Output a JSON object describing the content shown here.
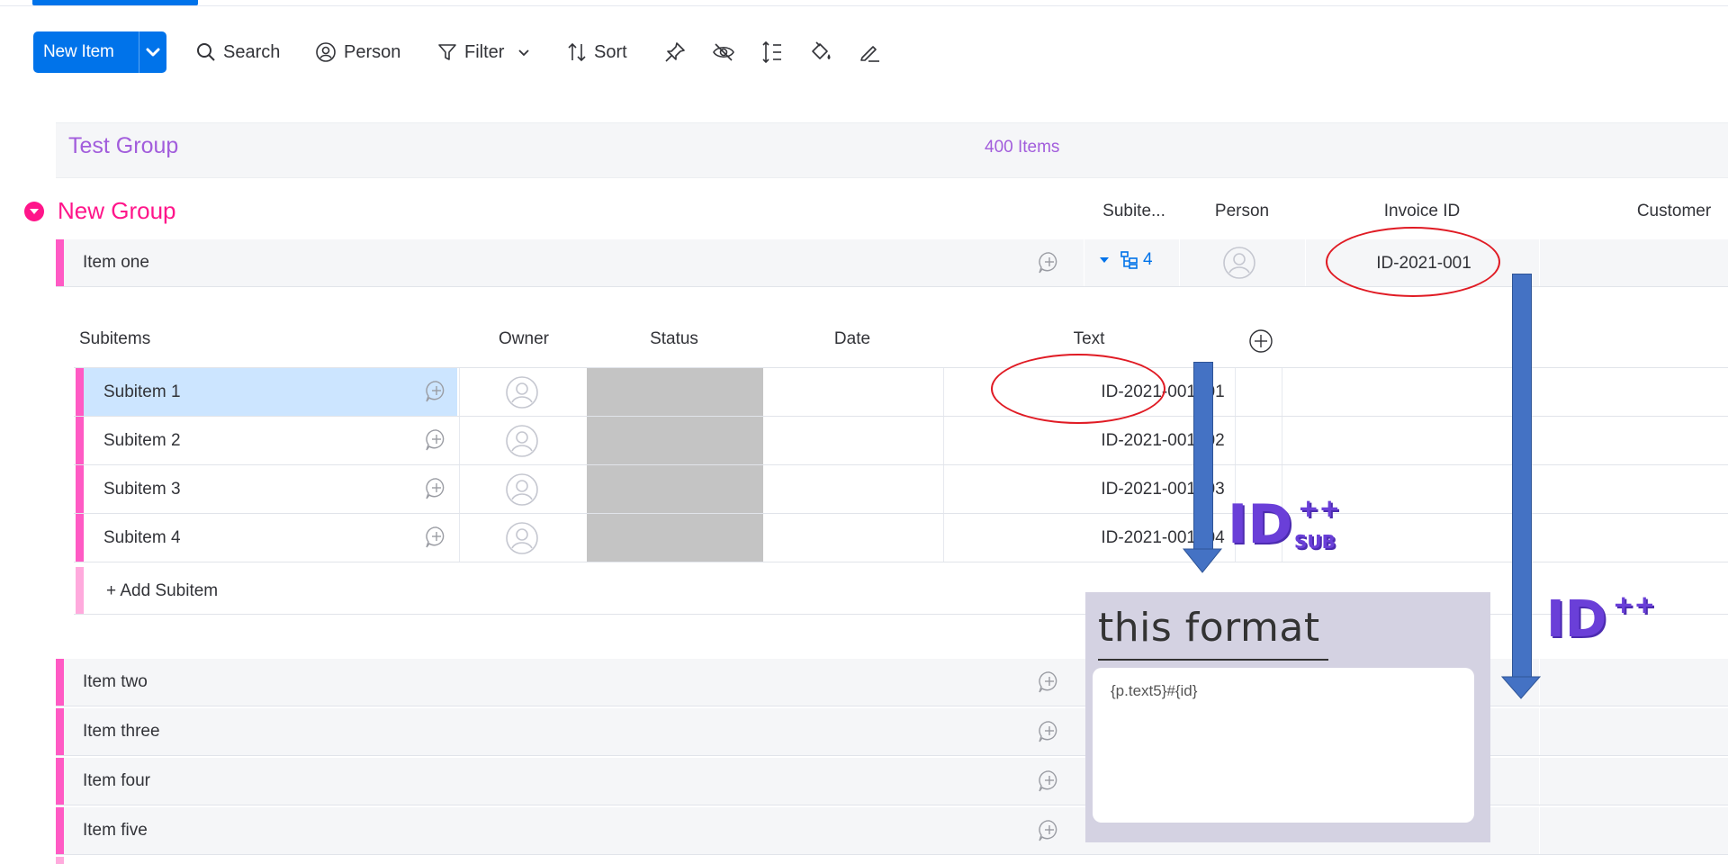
{
  "toolbar": {
    "new_item_label": "New Item",
    "search_label": "Search",
    "person_label": "Person",
    "filter_label": "Filter",
    "sort_label": "Sort"
  },
  "group1": {
    "title": "Test Group",
    "count": "400 Items"
  },
  "group2": {
    "title": "New Group",
    "columns": {
      "subitems": "Subite...",
      "person": "Person",
      "invoice_id": "Invoice ID",
      "customer": "Customer"
    }
  },
  "item_one": {
    "label": "Item one",
    "subitem_count": "4",
    "invoice_id": "ID-2021-001"
  },
  "subitems": {
    "headers": {
      "name": "Subitems",
      "owner": "Owner",
      "status": "Status",
      "date": "Date",
      "text": "Text"
    },
    "rows": [
      {
        "name": "Subitem 1",
        "text": "ID-2021-001#01"
      },
      {
        "name": "Subitem 2",
        "text": "ID-2021-001#02"
      },
      {
        "name": "Subitem 3",
        "text": "ID-2021-001#03"
      },
      {
        "name": "Subitem 4",
        "text": "ID-2021-001#04"
      }
    ],
    "add_label": "+ Add Subitem"
  },
  "items": [
    {
      "label": "Item two"
    },
    {
      "label": "Item three"
    },
    {
      "label": "Item four"
    },
    {
      "label": "Item five"
    }
  ],
  "annotations": {
    "sub_id_main": "ID",
    "sub_id_sup": "++",
    "sub_id_sub": "SUB",
    "id_main": "ID",
    "id_sup": "++",
    "format_title": "this format",
    "format_value": "{p.text5}#{id}"
  },
  "colors": {
    "primary": "#0073ea",
    "group1": "#a25ddc",
    "group2": "#ff158a",
    "item_stripe": "#ff5ac4",
    "arrow": "#4472c4",
    "oval": "#e01b24"
  }
}
